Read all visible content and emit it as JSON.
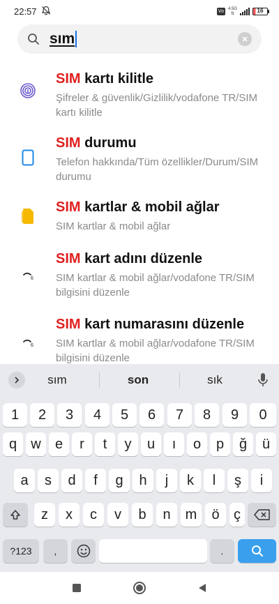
{
  "status_bar": {
    "time": "22:57",
    "net_type": "4.5G",
    "sim_label": "Vo",
    "battery": "16"
  },
  "search": {
    "query": "sım"
  },
  "results": [
    {
      "highlight": "SIM",
      "title_rest": " kartı kilitle",
      "subtitle": "Şifreler & güvenlik/Gizlilik/vodafone TR/SIM kartı kilitle",
      "icon": "fingerprint-icon"
    },
    {
      "highlight": "SIM",
      "title_rest": " durumu",
      "subtitle": "Telefon hakkında/Tüm özellikler/Durum/SIM durumu",
      "icon": "phone-outline-icon"
    },
    {
      "highlight": "SIM",
      "title_rest": " kartlar & mobil ağlar",
      "subtitle": "SIM kartlar & mobil ağlar",
      "icon": "sim-card-icon"
    },
    {
      "highlight": "SIM",
      "title_rest": " kart adını düzenle",
      "subtitle": "SIM kartlar & mobil ağlar/vodafone TR/SIM bilgisini düzenle",
      "icon": "loading-icon"
    },
    {
      "highlight": "SIM",
      "title_rest": " kart numarasını düzenle",
      "subtitle": "SIM kartlar & mobil ağlar/vodafone TR/SIM bilgisini düzenle",
      "icon": "loading-icon"
    }
  ],
  "keyboard": {
    "suggestions": [
      "sım",
      "son",
      "sık"
    ],
    "row_numbers": [
      "1",
      "2",
      "3",
      "4",
      "5",
      "6",
      "7",
      "8",
      "9",
      "0"
    ],
    "row1": [
      "q",
      "w",
      "e",
      "r",
      "t",
      "y",
      "u",
      "ı",
      "o",
      "p",
      "ğ",
      "ü"
    ],
    "row2": [
      "a",
      "s",
      "d",
      "f",
      "g",
      "h",
      "j",
      "k",
      "l",
      "ş",
      "i"
    ],
    "row3": [
      "z",
      "x",
      "c",
      "v",
      "b",
      "n",
      "m",
      "ö",
      "ç"
    ],
    "symbols_label": "?123",
    "comma": ",",
    "period": "."
  },
  "colors": {
    "accent": "#3aa0ee",
    "highlight": "#e02020",
    "fingerprint": "#6a5acd",
    "phone": "#1e88e5",
    "sim": "#f6b800"
  }
}
